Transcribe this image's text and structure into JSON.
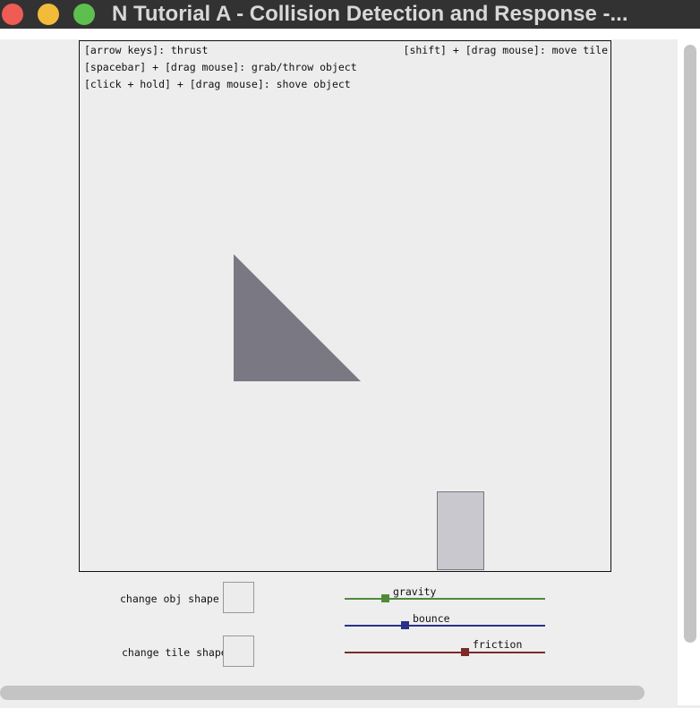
{
  "window": {
    "title": "N Tutorial A - Collision Detection and Response -..."
  },
  "hints": {
    "thrust": "[arrow keys]: thrust",
    "grab": "[spacebar] + [drag mouse]: grab/throw object",
    "shove": "[click + hold] + [drag mouse]: shove object",
    "move_tile": "[shift] + [drag mouse]: move tile"
  },
  "controls": {
    "change_obj_shape": "change obj shape",
    "change_tile_shape": "change tile shape"
  },
  "sliders": [
    {
      "label": "gravity",
      "value": 0.2,
      "color": "#4e8a3a"
    },
    {
      "label": "bounce",
      "value": 0.3,
      "color": "#2a3189"
    },
    {
      "label": "friction",
      "value": 0.6,
      "color": "#7e2a2a"
    }
  ],
  "colors": {
    "object_fill": "#797883",
    "tile_fill": "#c9c8cf"
  }
}
